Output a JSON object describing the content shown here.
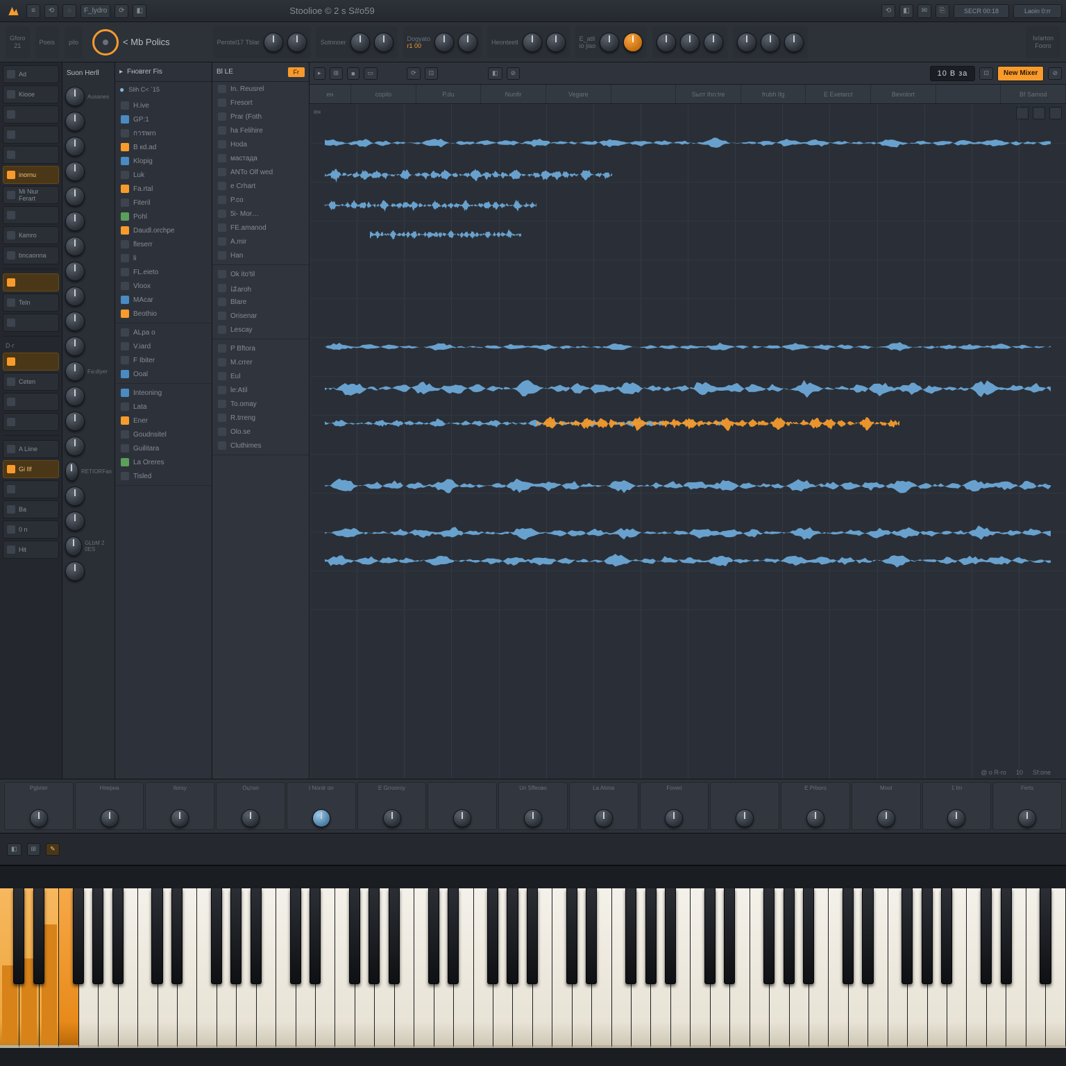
{
  "titlebar": {
    "app_menu": "FL",
    "file_label": "F_lydro",
    "center_title": "Stoolioe © 2 s S#o59",
    "right_items": [
      "⟲",
      "◧",
      "✉",
      "⎘",
      "⚙"
    ],
    "right_readouts": [
      "SECR 00:18",
      "Laoin 0:rr"
    ]
  },
  "toolbar": {
    "groups": [
      {
        "label": "Gforo",
        "sub": "21"
      },
      {
        "label": "Poeis",
        "sub": ""
      },
      {
        "label": "pilo",
        "sub": ""
      }
    ],
    "main_knob_label": "< Mb Polics",
    "sections": [
      {
        "label": "Perotel17 Tblar",
        "knobs": 2
      },
      {
        "label": "Sotnnoer",
        "knobs": 2
      },
      {
        "label": "Dogyato",
        "sub": "r1 00",
        "knobs": 2
      },
      {
        "label": "Heonteetl",
        "knobs": 2
      },
      {
        "label": "E_atll",
        "sub": "io jiao",
        "knobs": 2
      },
      {
        "label": "",
        "knobs": 3
      },
      {
        "label": "",
        "knobs": 3
      }
    ],
    "far_right": {
      "label": "Iv/arton",
      "sub": "Fooro"
    }
  },
  "rail": {
    "header": "",
    "items": [
      {
        "label": "Ad",
        "active": false
      },
      {
        "label": "Kiooe",
        "active": false
      },
      {
        "label": "",
        "active": false
      },
      {
        "label": "",
        "active": false
      },
      {
        "label": "",
        "active": false
      },
      {
        "label": "inornu",
        "active": true
      },
      {
        "label": "Mi Niur Ferart",
        "active": false
      },
      {
        "label": "",
        "active": false
      },
      {
        "label": "Каmro",
        "active": false
      },
      {
        "label": "bncaonna",
        "active": false
      }
    ],
    "items2": [
      {
        "label": "",
        "active": true
      },
      {
        "label": "Teln",
        "active": false
      },
      {
        "label": "",
        "active": false
      }
    ],
    "section3_head": "D·r",
    "items3": [
      {
        "label": "",
        "active": true
      },
      {
        "label": "Ceten",
        "active": false
      },
      {
        "label": "",
        "active": false
      },
      {
        "label": "",
        "active": false
      }
    ],
    "items4": [
      {
        "label": "A Liine",
        "active": false
      },
      {
        "label": "Gi Ilf",
        "active": true
      },
      {
        "label": "",
        "active": false
      },
      {
        "label": "Ba",
        "active": false
      },
      {
        "label": "0 n",
        "active": false
      },
      {
        "label": "Hit",
        "active": false
      }
    ]
  },
  "channels": {
    "header": "Suon Herll",
    "rows": [
      {
        "label": "Ausanes"
      },
      {
        "label": ""
      },
      {
        "label": ""
      },
      {
        "label": ""
      },
      {
        "label": ""
      },
      {
        "label": ""
      },
      {
        "label": ""
      },
      {
        "label": ""
      },
      {
        "label": ""
      },
      {
        "label": ""
      },
      {
        "label": ""
      },
      {
        "label": "Fa:diyer"
      },
      {
        "label": ""
      },
      {
        "label": ""
      },
      {
        "label": ""
      },
      {
        "label": "RETIORFan"
      },
      {
        "label": ""
      },
      {
        "label": ""
      },
      {
        "label": "GLbM 2 0ES"
      },
      {
        "label": ""
      }
    ]
  },
  "browser1": {
    "head_icon": "▸",
    "head_label": "Fновrer Fis",
    "sub_icon": "●",
    "sub_label": "Slih C< `15",
    "groups": [
      {
        "title": "",
        "items": [
          {
            "label": "H.ive",
            "cls": ""
          },
          {
            "label": "GP:1",
            "cls": "blue"
          },
          {
            "label": "การพrn",
            "cls": ""
          },
          {
            "label": "B кd.ad",
            "cls": "orange"
          },
          {
            "label": "Klopig",
            "cls": "blue"
          },
          {
            "label": "Luk",
            "cls": ""
          },
          {
            "label": "Fa.rtal",
            "cls": "orange"
          },
          {
            "label": "Fiteril",
            "cls": ""
          },
          {
            "label": "Pohl",
            "cls": "green"
          },
          {
            "label": "Daudl.orchpe",
            "cls": "orange"
          },
          {
            "label": "fleserr",
            "cls": ""
          },
          {
            "label": "li",
            "cls": ""
          },
          {
            "label": "FL.eieto",
            "cls": ""
          },
          {
            "label": "Vlооx",
            "cls": ""
          },
          {
            "label": "MAcar",
            "cls": "blue"
          },
          {
            "label": "Beothio",
            "cls": "orange"
          }
        ]
      },
      {
        "title": "",
        "items": [
          {
            "label": "ALра o",
            "cls": ""
          },
          {
            "label": "V.iard",
            "cls": ""
          },
          {
            "label": "F Ibiter",
            "cls": ""
          },
          {
            "label": "Ooal",
            "cls": "blue"
          }
        ]
      },
      {
        "title": "",
        "items": [
          {
            "label": "Inteoning",
            "cls": "blue"
          },
          {
            "label": "Lata",
            "cls": ""
          },
          {
            "label": "Ener",
            "cls": "orange"
          },
          {
            "label": "Goudnsitel",
            "cls": ""
          },
          {
            "label": "Guilitara",
            "cls": ""
          },
          {
            "label": "La Oreres",
            "cls": "green"
          },
          {
            "label": "Tisled",
            "cls": ""
          }
        ]
      }
    ]
  },
  "browser2": {
    "head_left": "Bl  LE",
    "head_chip": "Fr",
    "groups": [
      {
        "title": "",
        "items": [
          {
            "label": "In. Reusrel"
          },
          {
            "label": "Fresort"
          },
          {
            "label": "Prar (Foth"
          },
          {
            "label": "ha Felihire"
          },
          {
            "label": "Hoda"
          },
          {
            "label": "мастадa"
          },
          {
            "label": "ANTo Olf wed"
          },
          {
            "label": "e Crhart"
          },
          {
            "label": "P.co"
          },
          {
            "label": "5i- Mor…"
          },
          {
            "label": "FE.amanod"
          },
          {
            "label": "A.mir"
          },
          {
            "label": "Han"
          }
        ]
      },
      {
        "title": "",
        "items": [
          {
            "label": "Ok ito'til"
          },
          {
            "label": "はaroh"
          },
          {
            "label": "Blare"
          },
          {
            "label": "Orisenar"
          },
          {
            "label": "Lescay"
          }
        ]
      },
      {
        "title": "",
        "items": [
          {
            "label": "P Bftora"
          },
          {
            "label": "M.crrer"
          },
          {
            "label": "Eul"
          },
          {
            "label": "le:Atil"
          },
          {
            "label": "To.omay"
          },
          {
            "label": "R.trreng"
          },
          {
            "label": "Olo.se"
          },
          {
            "label": "Cluthimes"
          }
        ]
      }
    ]
  },
  "main": {
    "toolbar_buttons": [
      "▸",
      "⊞",
      "■",
      "▭",
      "⟳",
      "⊡",
      "◧",
      "⊘"
    ],
    "readout": "10 B за",
    "render_btn": "New Mixer",
    "track_headers": [
      "ен",
      "copilo",
      "P.du",
      "Nunfir",
      "Vegare",
      "",
      "Sьот Ihn:tre",
      "frubh Ilg",
      "E Exetarct",
      "Bevolort",
      "",
      "Bf Samod"
    ],
    "footer": [
      "@ o R·ro",
      "10",
      "Sf:one",
      ""
    ],
    "ruler_label": "ен"
  },
  "mixer": {
    "channels": [
      {
        "label": "Pgbrier"
      },
      {
        "label": "Нперна"
      },
      {
        "label": "Ilorsy"
      },
      {
        "label": "Оцтил"
      },
      {
        "label": "I Nordr on",
        "sel": true
      },
      {
        "label": "E Grrooroy"
      },
      {
        "label": ""
      },
      {
        "label": "Un Sffeово"
      },
      {
        "label": "La Alıma"
      },
      {
        "label": "Foveri"
      },
      {
        "label": ""
      },
      {
        "label": "E Prboro"
      },
      {
        "label": "Mool"
      },
      {
        "label": "1 Im"
      },
      {
        "label": "Ferts"
      }
    ]
  },
  "minibar": {
    "buttons": [
      "◧",
      "⊞",
      "✎"
    ]
  },
  "piano": {
    "white_count": 54,
    "orange_highlight_whites": [
      0,
      1,
      2,
      3
    ],
    "bars_on_whites": [
      0,
      1,
      2
    ]
  }
}
